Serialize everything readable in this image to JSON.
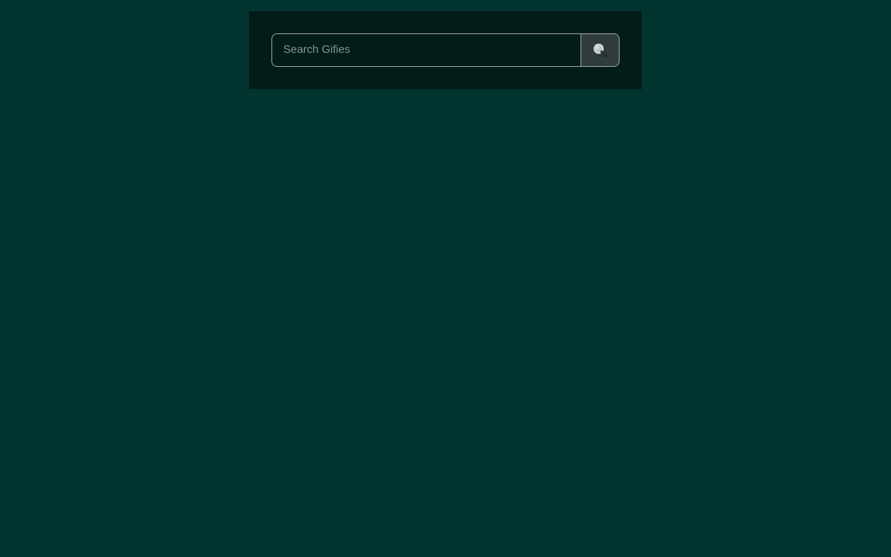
{
  "search": {
    "placeholder": "Search Gifies",
    "value": "",
    "button_icon": "search-icon"
  },
  "colors": {
    "page_background": "#023430",
    "panel_background": "#021c19",
    "input_border": "#a9b3b2",
    "button_background": "#2f3c3b"
  }
}
